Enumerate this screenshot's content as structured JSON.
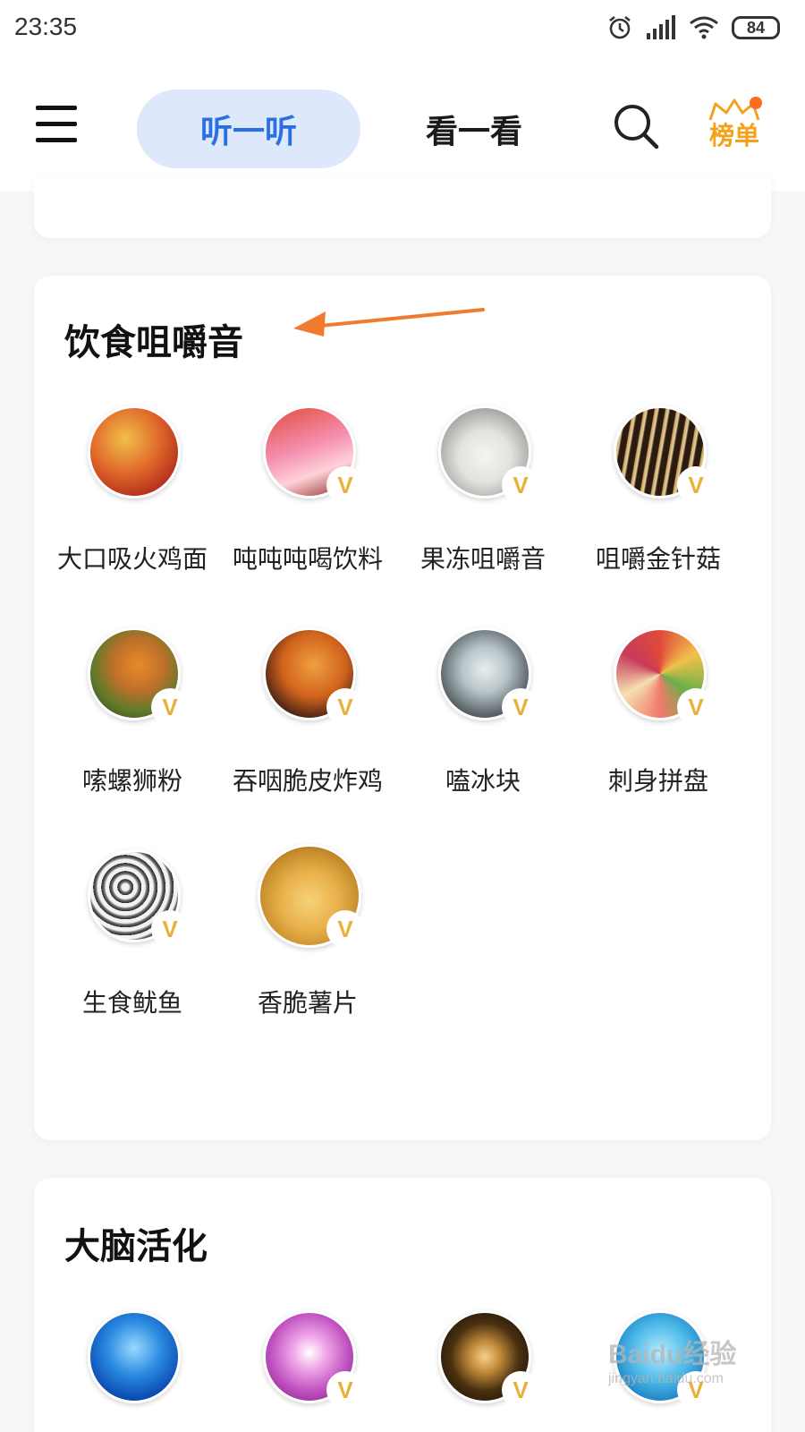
{
  "status_bar": {
    "time": "23:35",
    "battery": "84"
  },
  "header": {
    "tabs": [
      "听一听",
      "看一看"
    ],
    "rank_label": "榜单",
    "colors": {
      "active_tab_bg": "#dde9fb",
      "active_tab_text": "#2b6fe0",
      "rank": "#f3a21a"
    }
  },
  "sections": [
    {
      "title": "饮食咀嚼音",
      "items": [
        {
          "label": "大口吸火鸡面",
          "vip": false
        },
        {
          "label": "吨吨吨喝饮料",
          "vip": true
        },
        {
          "label": "果冻咀嚼音",
          "vip": true
        },
        {
          "label": "咀嚼金针菇",
          "vip": true
        },
        {
          "label": "嗦螺狮粉",
          "vip": true
        },
        {
          "label": "吞咽脆皮炸鸡",
          "vip": true
        },
        {
          "label": "嗑冰块",
          "vip": true
        },
        {
          "label": "刺身拼盘",
          "vip": true
        },
        {
          "label": "生食鱿鱼",
          "vip": true
        },
        {
          "label": "香脆薯片",
          "vip": true
        }
      ]
    },
    {
      "title": "大脑活化",
      "items": [
        {
          "vip": false
        },
        {
          "vip": true
        },
        {
          "vip": true
        },
        {
          "vip": true
        }
      ]
    }
  ],
  "vip_badge_text": "V",
  "watermark": {
    "brand": "Baidu经验",
    "url": "jingyan.baidu.com"
  }
}
